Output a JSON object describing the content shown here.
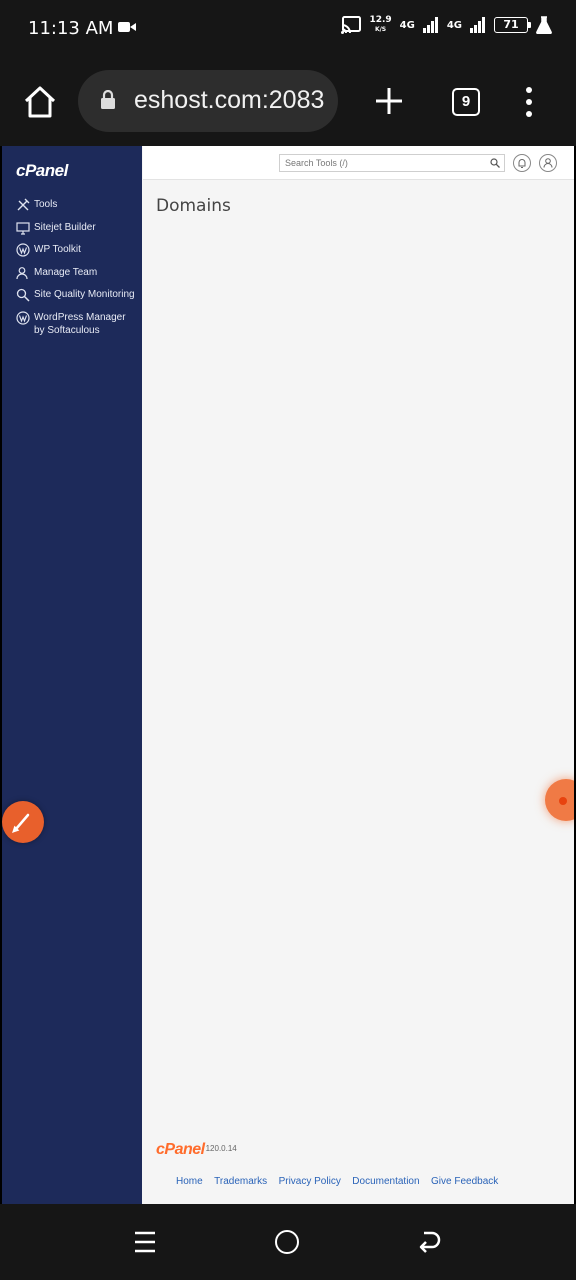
{
  "status_bar": {
    "time": "11:13 AM",
    "speed_value": "12.9",
    "speed_unit": "K/S",
    "net1": "4G",
    "net2": "4G",
    "battery": "71"
  },
  "browser": {
    "url": "eshost.com:2083",
    "tab_count": "9"
  },
  "sidebar": {
    "logo": "cPanel",
    "items": [
      {
        "label": "Tools",
        "icon": "tools-icon"
      },
      {
        "label": "Sitejet Builder",
        "icon": "monitor-icon"
      },
      {
        "label": "WP Toolkit",
        "icon": "wordpress-icon"
      },
      {
        "label": "Manage Team",
        "icon": "team-icon"
      },
      {
        "label": "Site Quality Monitoring",
        "icon": "search-quality-icon"
      },
      {
        "label": "WordPress Manager by Softaculous",
        "icon": "wordpress-icon"
      }
    ]
  },
  "topbar": {
    "search_placeholder": "Search Tools (/)"
  },
  "main": {
    "title": "Domains"
  },
  "footer": {
    "logo": "cPanel",
    "version": "120.0.14",
    "links": [
      "Home",
      "Trademarks",
      "Privacy Policy",
      "Documentation",
      "Give Feedback"
    ]
  },
  "colors": {
    "sidebar_bg": "#1d2a5a",
    "brand_orange": "#ff6c2c",
    "link_blue": "#2a63b8"
  }
}
